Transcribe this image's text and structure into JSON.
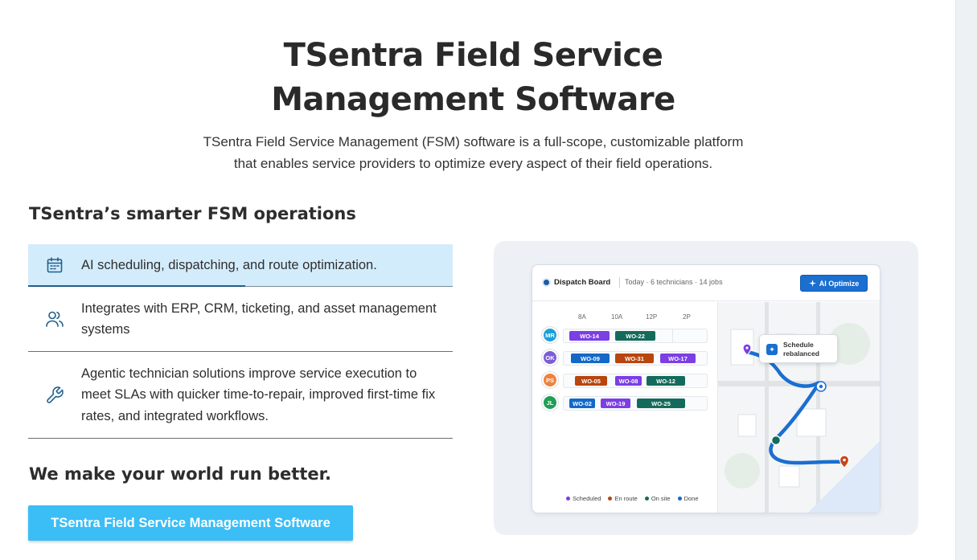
{
  "hero": {
    "title_line1": "TSentra Field Service",
    "title_line2": "Management Software",
    "subtitle_line1": "TSentra Field Service Management (FSM) software is a full-scope, customizable platform",
    "subtitle_line2": "that enables service providers to optimize every aspect of their field operations."
  },
  "features": {
    "heading": "TSentra’s smarter FSM operations",
    "items": [
      {
        "icon": "calendar-icon",
        "text": "AI scheduling, dispatching, and route optimization.",
        "active": true,
        "progress": 0.51
      },
      {
        "icon": "users-icon",
        "text": "Integrates with ERP, CRM, ticketing, and asset management systems"
      },
      {
        "icon": "wrench-icon",
        "text": "Agentic technician solutions improve service execution to meet SLAs with quicker time-to-repair, improved first-time fix rates, and integrated workflows."
      }
    ]
  },
  "tagline": "We make your world run better.",
  "cta_label": "TSentra Field Service Management Software",
  "dispatch": {
    "title": "Dispatch Board",
    "meta": "Today · 6 technicians · 14 jobs",
    "ai_button": "AI Optimize",
    "times": [
      "8A",
      "10A",
      "12P",
      "2P"
    ],
    "technicians": [
      {
        "initials": "MR",
        "color": "#1aa0d8",
        "jobs": [
          {
            "id": "WO-14",
            "status": "scheduled"
          },
          {
            "id": "WO-22",
            "status": "onsite"
          }
        ]
      },
      {
        "initials": "OK",
        "color": "#7d5cd6",
        "jobs": [
          {
            "id": "WO-09",
            "status": "done"
          },
          {
            "id": "WO-31",
            "status": "enroute"
          },
          {
            "id": "WO-17",
            "status": "scheduled"
          }
        ]
      },
      {
        "initials": "PS",
        "color": "#f0823a",
        "jobs": [
          {
            "id": "WO-05",
            "status": "enroute"
          },
          {
            "id": "WO-08",
            "status": "scheduled"
          },
          {
            "id": "WO-12",
            "status": "onsite"
          }
        ]
      },
      {
        "initials": "JL",
        "color": "#1f9e57",
        "jobs": [
          {
            "id": "WO-02",
            "status": "done"
          },
          {
            "id": "WO-19",
            "status": "scheduled"
          },
          {
            "id": "WO-25",
            "status": "onsite"
          }
        ]
      }
    ],
    "legend": [
      "Scheduled",
      "En route",
      "On site",
      "Done"
    ],
    "legend_colors": [
      "#7b3fe4",
      "#b8460e",
      "#146b5c",
      "#1469c7"
    ],
    "toast": "Schedule rebalanced"
  }
}
